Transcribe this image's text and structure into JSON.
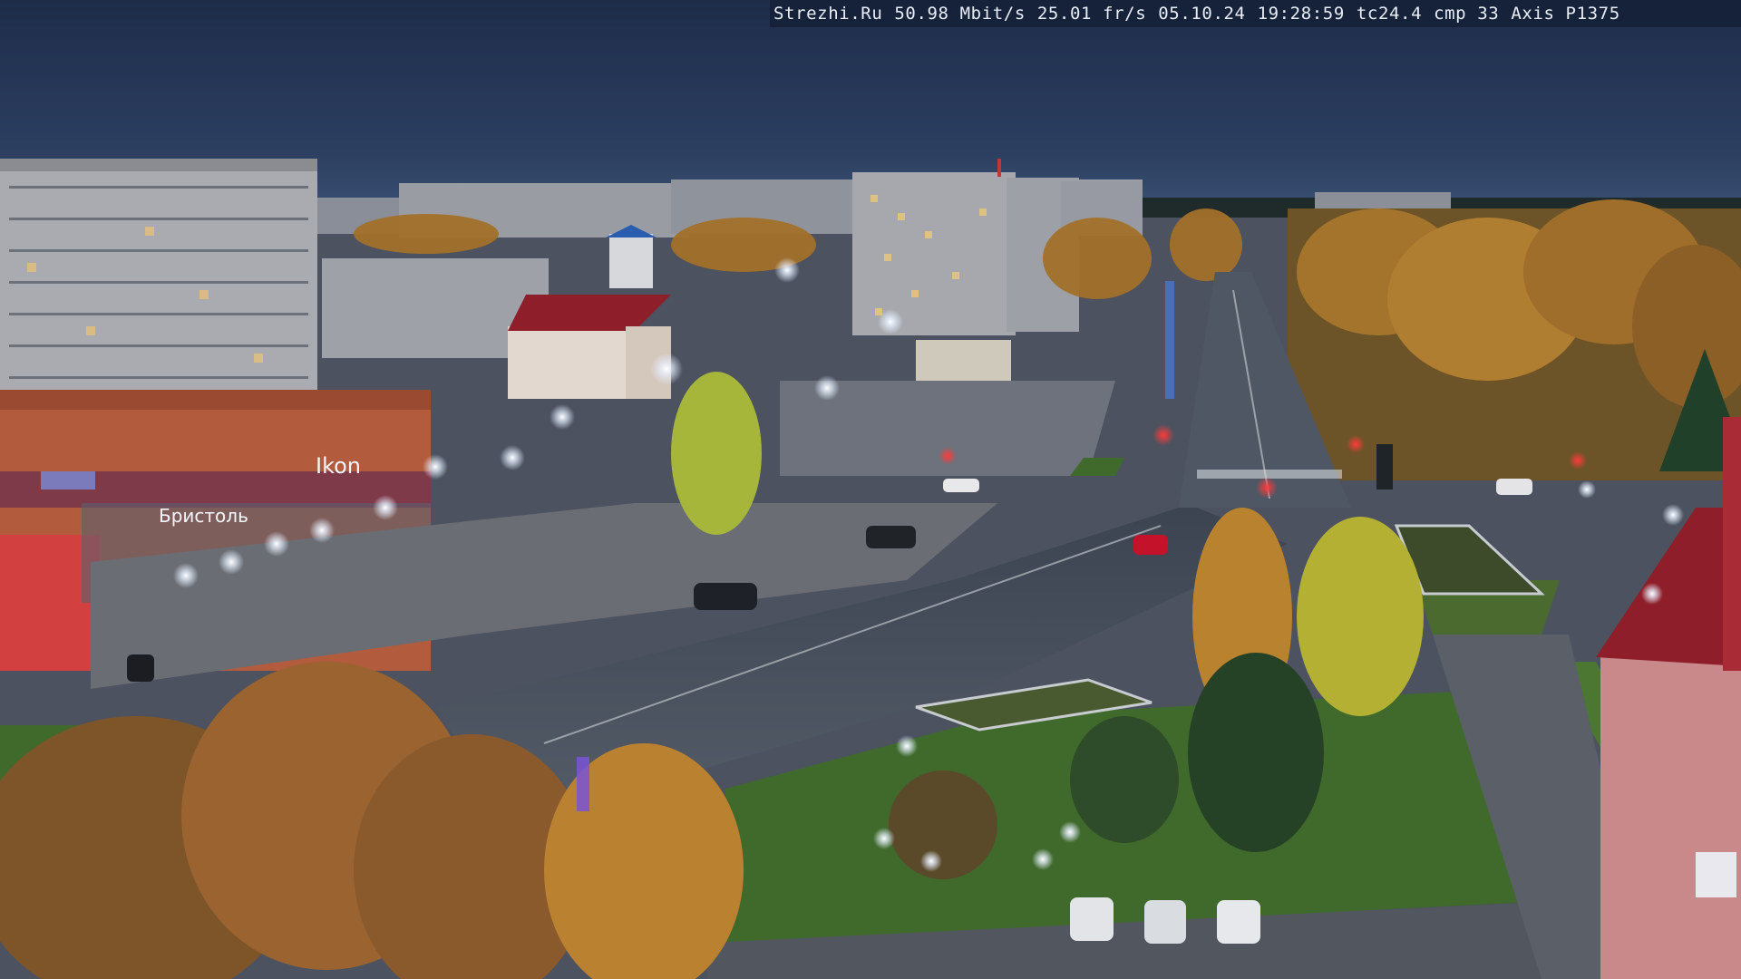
{
  "overlay": {
    "site": "Strezhi.Ru",
    "bitrate": "50.98 Mbit/s",
    "framerate": "25.01 fr/s",
    "date": "05.10.24",
    "time": "19:28:59",
    "tc": "tc24.4",
    "cmp": "cmp 33",
    "camera": "Axis P1375"
  },
  "signs": {
    "store_sign": "Бристоль",
    "shop_sign": "Ikon"
  },
  "palette": {
    "sky_top": "#1e2c4a",
    "sky_horizon": "#3b5274",
    "road": "#4a5260",
    "grass": "#3f6a2c",
    "autumn": "#b9822e",
    "roof_red": "#8e1f2a"
  }
}
